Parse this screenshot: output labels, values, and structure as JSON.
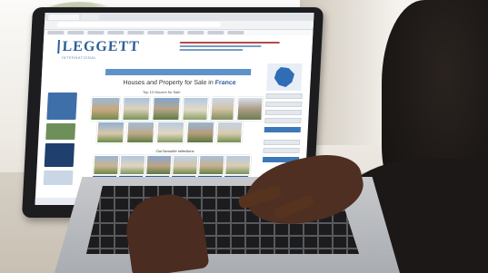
{
  "site": {
    "logo_text": "LEGGETT",
    "logo_subtitle": "INTERNATIONAL",
    "title_prefix": "Houses and Property for Sale in",
    "title_country": "France",
    "subtitle": "Top 10 Houses for Sale",
    "section_recent": "Our favourite selections"
  },
  "colors": {
    "brand_blue": "#2e5f98",
    "nav_blue": "#5e92c9",
    "accent_red": "#b74a4a",
    "laptop_dark": "#1d1d1f"
  },
  "photos_top_row": 5,
  "photos_mid_row": 6,
  "photos_bottom_row": 6
}
